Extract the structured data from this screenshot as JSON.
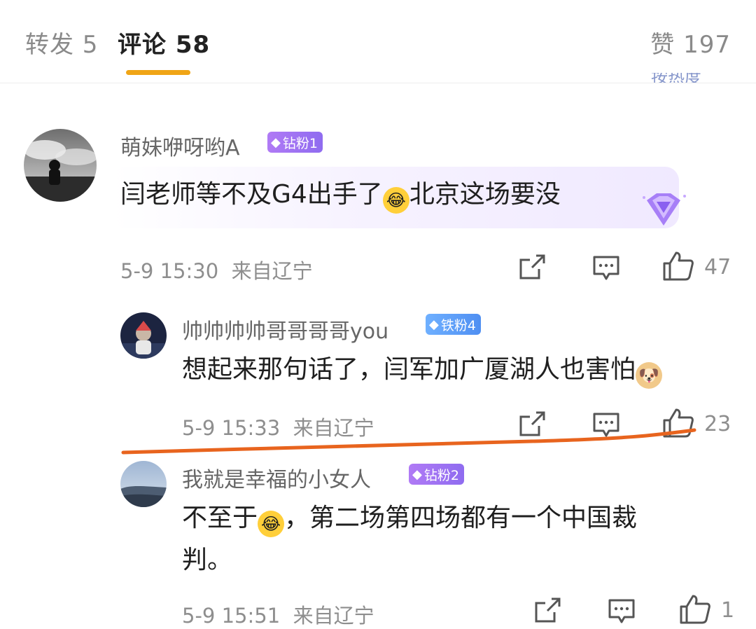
{
  "tabs": {
    "repost": "转发 5",
    "comments": "评论 58",
    "likes": "赞 197"
  },
  "sort_hint": "按热度",
  "colors": {
    "tab_indicator": "#f0a516",
    "badge_diamond": "#9b72f2",
    "badge_iron": "#5b9cf7",
    "annotation_line": "#e8641e"
  },
  "comments": [
    {
      "user": "萌妹咿呀哟A",
      "badge": "钻粉1",
      "text_before": "闫老师等不及G4出手了",
      "emoji": "laugh-cry-emoji",
      "text_after": "北京这场要没",
      "time": "5-9 15:30",
      "location": "来自辽宁",
      "likes": "47"
    },
    {
      "user": "帅帅帅帅哥哥哥哥you",
      "badge": "铁粉4",
      "text_before": "想起来那句话了，闫军加广厦湖人也害怕",
      "emoji": "doge-emoji",
      "text_after": "",
      "time": "5-9 15:33",
      "location": "来自辽宁",
      "likes": "23"
    },
    {
      "user": "我就是幸福的小女人",
      "badge": "钻粉2",
      "text_before": "不至于",
      "emoji": "laugh-cry-emoji",
      "text_after": "，第二场第四场都有一个中国裁",
      "text_line2": "判。",
      "time": "5-9 15:51",
      "location": "来自辽宁",
      "likes": "1"
    }
  ]
}
